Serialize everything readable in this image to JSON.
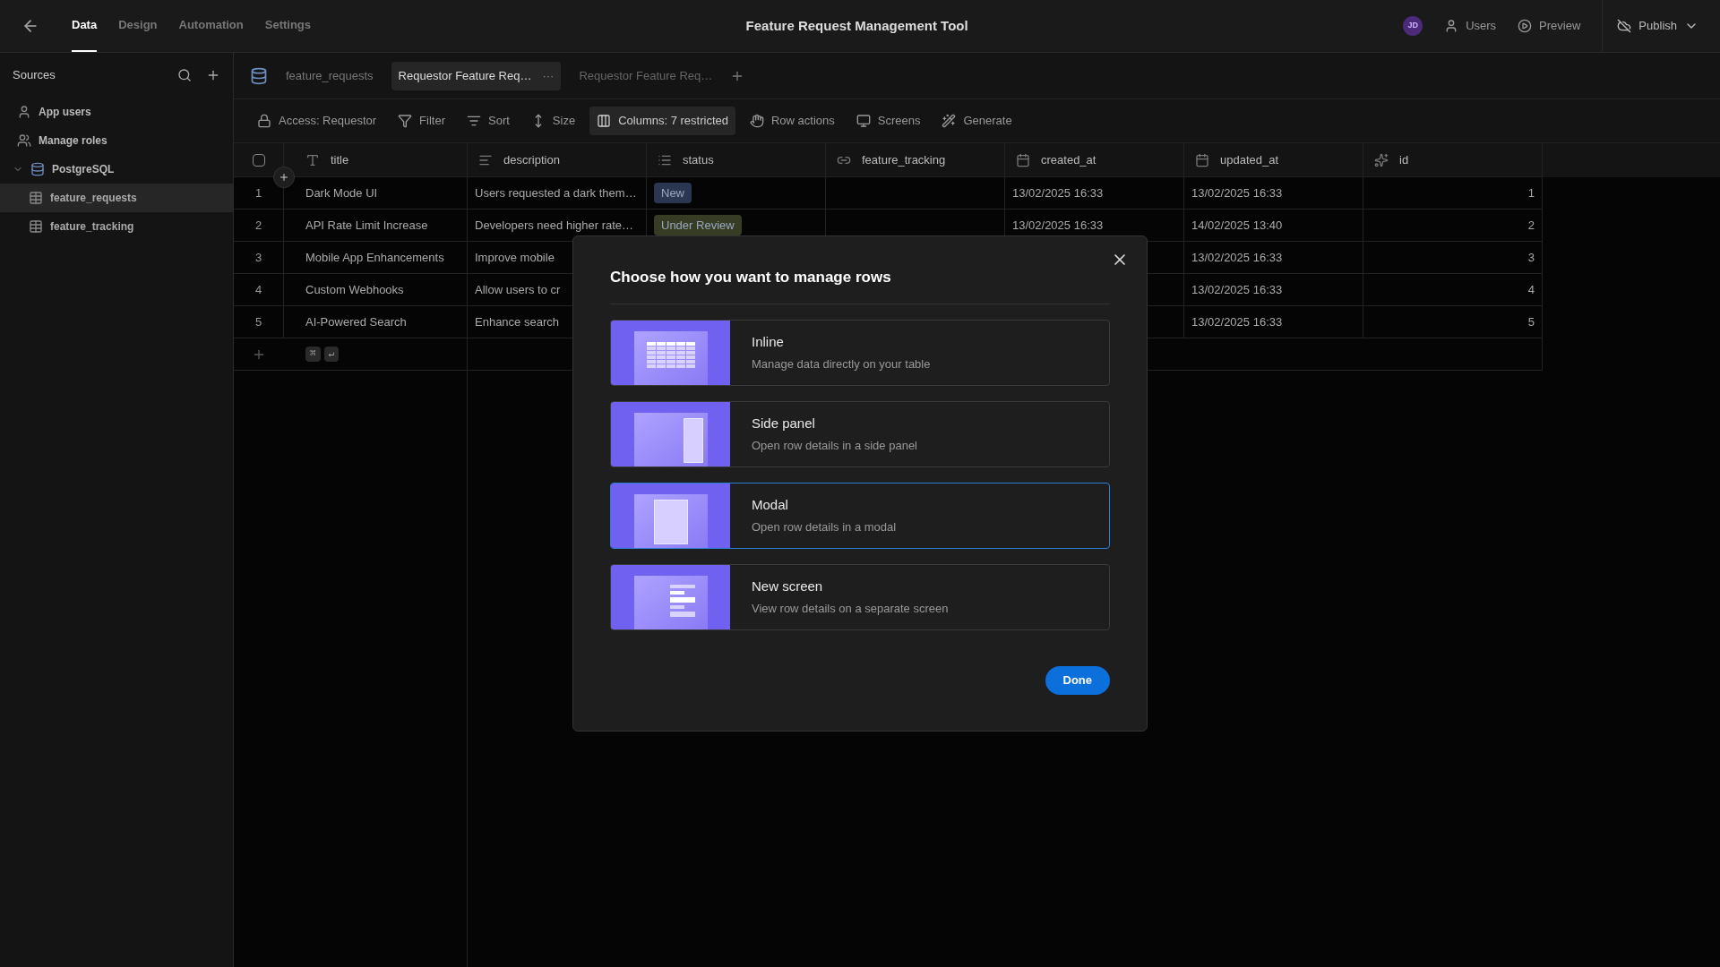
{
  "top_bar": {
    "nav_tabs": [
      {
        "label": "Data",
        "selected": true
      },
      {
        "label": "Design",
        "selected": false
      },
      {
        "label": "Automation",
        "selected": false
      },
      {
        "label": "Settings",
        "selected": false
      }
    ],
    "title": "Feature Request Management Tool",
    "avatar": "JD",
    "users": "Users",
    "preview": "Preview",
    "publish": "Publish"
  },
  "sidebar": {
    "title": "Sources",
    "items": [
      {
        "label": "App users",
        "kind": "users",
        "selected": false
      },
      {
        "label": "Manage roles",
        "kind": "roles",
        "selected": false
      },
      {
        "label": "PostgreSQL",
        "kind": "database",
        "selected": false,
        "expanded": true,
        "children": [
          {
            "label": "feature_requests",
            "kind": "table",
            "selected": true
          },
          {
            "label": "feature_tracking",
            "kind": "table",
            "selected": false
          }
        ]
      }
    ]
  },
  "tabs": {
    "source": "feature_requests",
    "items": [
      {
        "label": "Requestor Feature Req…",
        "selected": true,
        "more": "···"
      },
      {
        "label": "Requestor Feature Req…",
        "selected": false
      }
    ]
  },
  "toolbar": [
    {
      "label": "Access: Requestor",
      "active": false
    },
    {
      "label": "Filter",
      "active": false
    },
    {
      "label": "Sort",
      "active": false
    },
    {
      "label": "Size",
      "active": false
    },
    {
      "label": "Columns: 7 restricted",
      "active": true
    },
    {
      "label": "Row actions",
      "active": false
    },
    {
      "label": "Screens",
      "active": false
    },
    {
      "label": "Generate",
      "active": false
    }
  ],
  "table": {
    "select_all_checked": false,
    "columns": [
      {
        "label": "title",
        "kind": "text"
      },
      {
        "label": "description",
        "kind": "longform"
      },
      {
        "label": "status",
        "kind": "options"
      },
      {
        "label": "feature_tracking",
        "kind": "relationship"
      },
      {
        "label": "created_at",
        "kind": "datetime"
      },
      {
        "label": "updated_at",
        "kind": "datetime"
      },
      {
        "label": "id",
        "kind": "auto"
      }
    ],
    "rows": [
      {
        "number": "1",
        "title": "Dark Mode UI",
        "description": "Users requested a dark them…",
        "status": {
          "label": "New",
          "color": "#2b3650"
        },
        "created_at": "13/02/2025 16:33",
        "updated_at": "13/02/2025 16:33",
        "id": "1"
      },
      {
        "number": "2",
        "title": "API Rate Limit Increase",
        "description": "Developers need higher rate…",
        "status": {
          "label": "Under Review",
          "color": "#363d24"
        },
        "created_at": "13/02/2025 16:33",
        "updated_at": "14/02/2025 13:40",
        "id": "2"
      },
      {
        "number": "3",
        "title": "Mobile App Enhancements",
        "description": "Improve mobile",
        "updated_at": "13/02/2025 16:33",
        "id": "3"
      },
      {
        "number": "4",
        "title": "Custom Webhooks",
        "description": "Allow users to cr",
        "updated_at": "13/02/2025 16:33",
        "id": "4"
      },
      {
        "number": "5",
        "title": "AI-Powered Search",
        "description": "Enhance search",
        "updated_at": "13/02/2025 16:33",
        "id": "5"
      }
    ],
    "add_row": {
      "keys": [
        "⌘",
        "↵"
      ]
    }
  },
  "modal": {
    "title": "Choose how you want to manage rows",
    "options": [
      {
        "kind": "inline",
        "title": "Inline",
        "description": "Manage data directly on your table",
        "selected": false
      },
      {
        "kind": "side_panel",
        "title": "Side panel",
        "description": "Open row details in a side panel",
        "selected": false
      },
      {
        "kind": "modal",
        "title": "Modal",
        "description": "Open row details in a modal",
        "selected": true
      },
      {
        "kind": "new_screen",
        "title": "New screen",
        "description": "View row details on a separate screen",
        "selected": false
      }
    ],
    "done": "Done"
  }
}
